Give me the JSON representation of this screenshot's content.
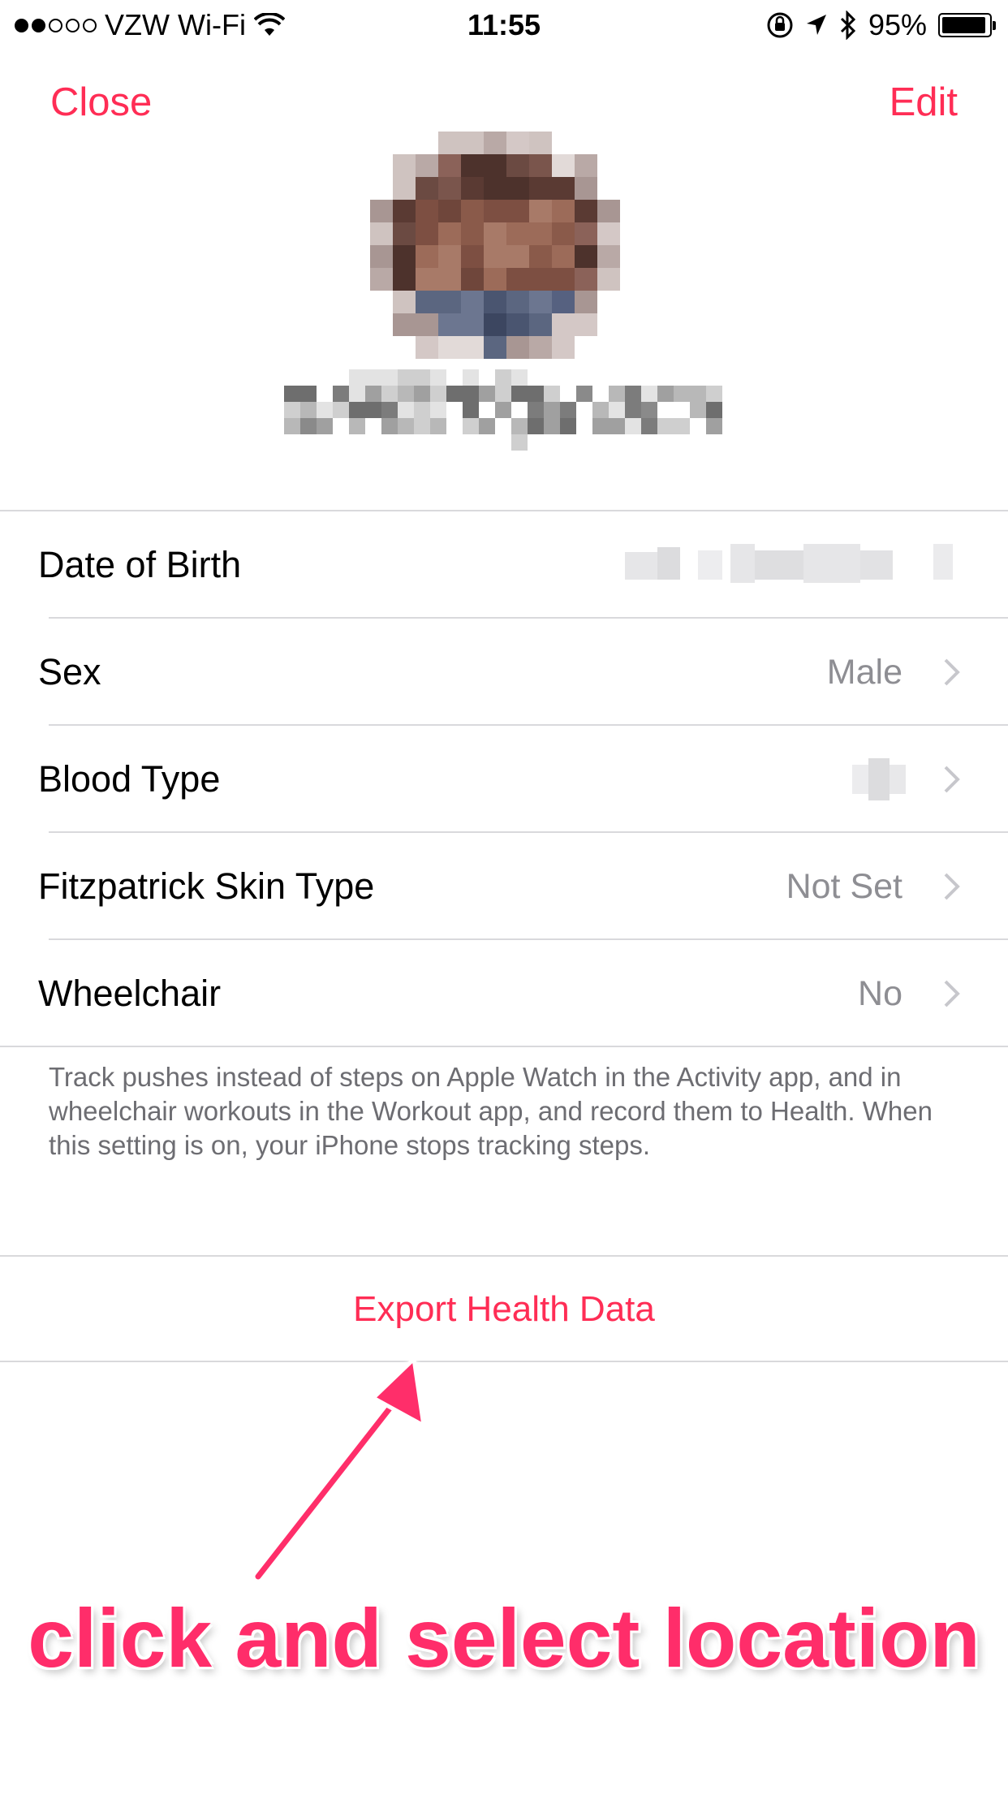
{
  "status_bar": {
    "carrier": "VZW Wi-Fi",
    "time": "11:55",
    "battery": "95%",
    "battery_level": 0.95,
    "icons": [
      "wifi-icon",
      "orientation-lock-icon",
      "location-icon",
      "bluetooth-icon",
      "battery-icon"
    ]
  },
  "nav": {
    "close_label": "Close",
    "edit_label": "Edit"
  },
  "profile": {
    "avatar": "pixelated-avatar",
    "name": "pixelated-name"
  },
  "rows": [
    {
      "label": "Date of Birth",
      "value": "",
      "redacted": true,
      "chevron": false
    },
    {
      "label": "Sex",
      "value": "Male",
      "redacted": false,
      "chevron": true
    },
    {
      "label": "Blood Type",
      "value": "",
      "redacted": true,
      "chevron": true
    },
    {
      "label": "Fitzpatrick Skin Type",
      "value": "Not Set",
      "redacted": false,
      "chevron": true
    },
    {
      "label": "Wheelchair",
      "value": "No",
      "redacted": false,
      "chevron": true
    }
  ],
  "footnote": "Track pushes instead of steps on Apple Watch in the Activity app, and in wheelchair workouts in the Workout app, and record them to Health. When this setting is on, your iPhone stops tracking steps.",
  "export_label": "Export Health Data",
  "annotation": {
    "text": "click and select location",
    "color": "#ff2d6a"
  },
  "colors": {
    "accent": "#ff2d55",
    "secondary_text": "#8e8e93",
    "separator": "#d9d9dc"
  }
}
